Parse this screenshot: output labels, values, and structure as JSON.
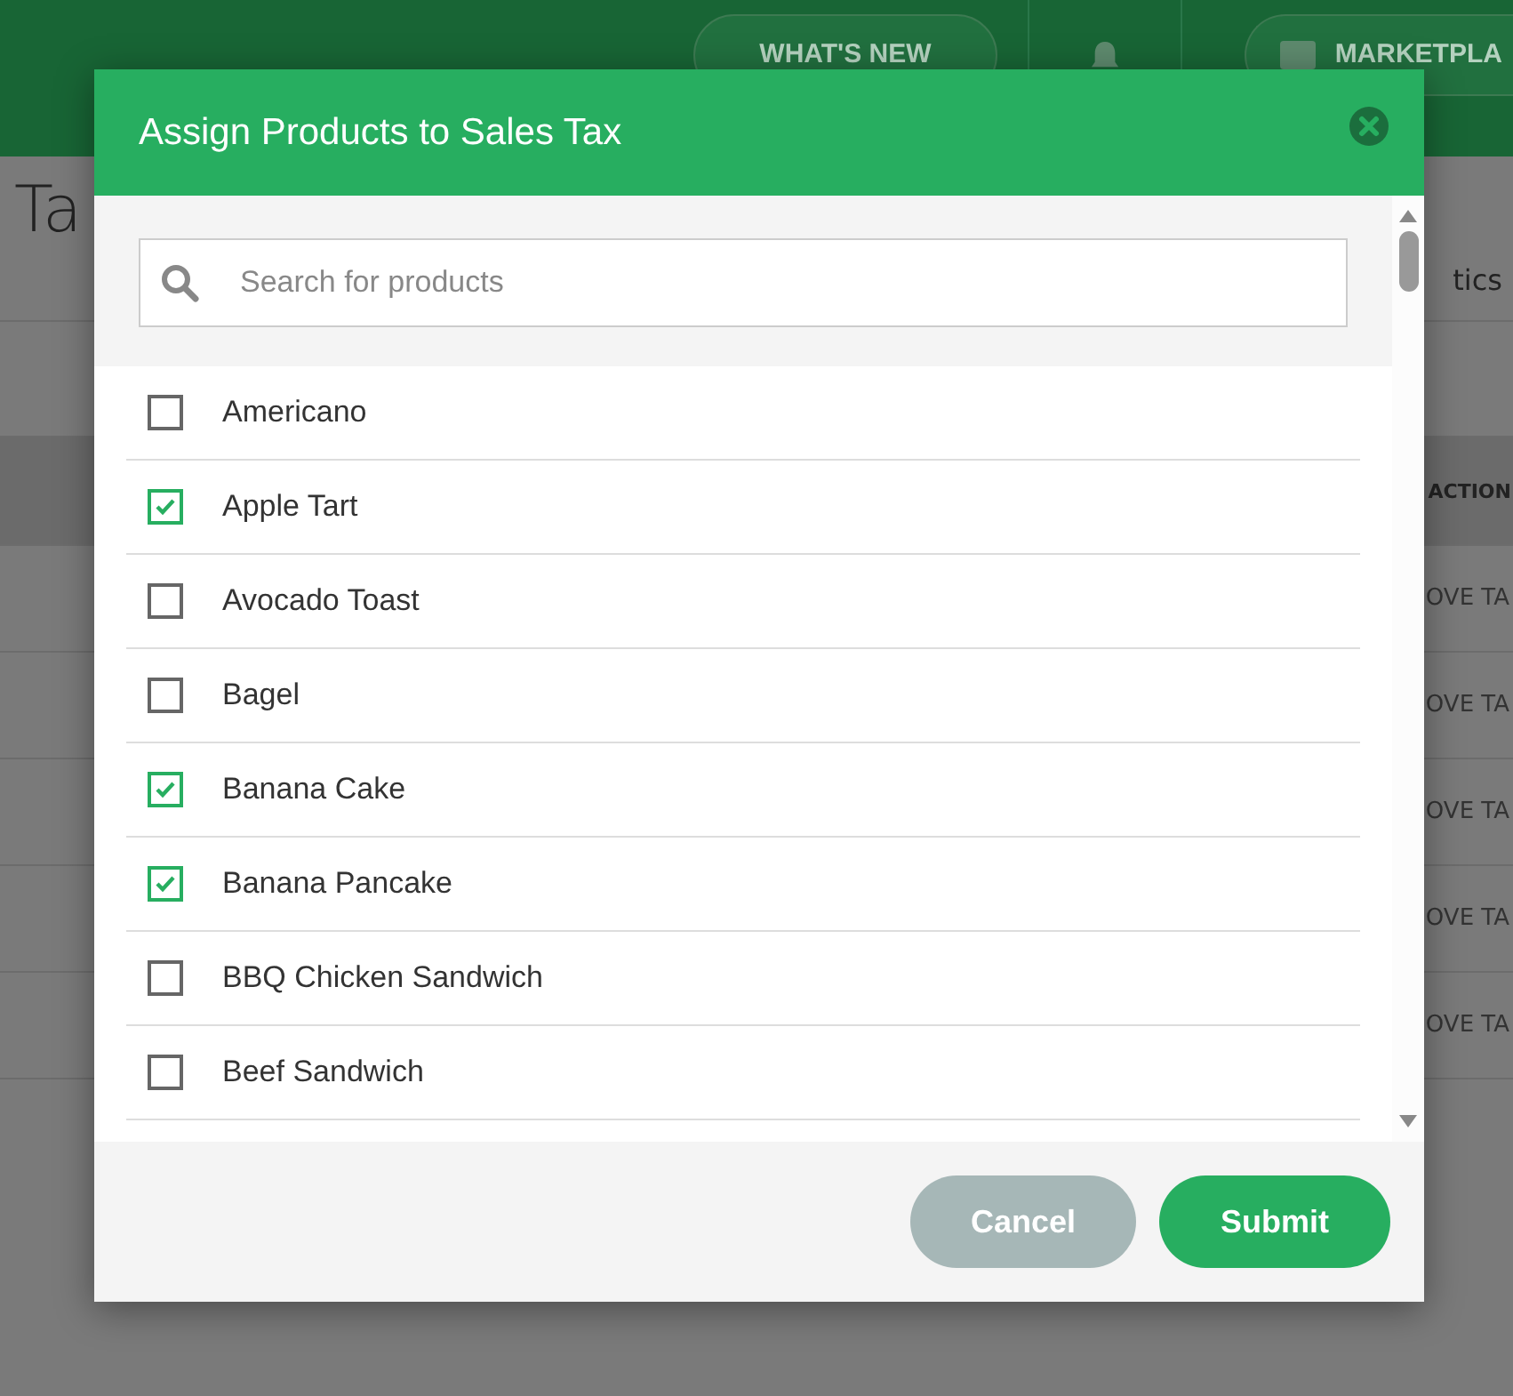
{
  "header": {
    "whats_new": "WHAT'S NEW",
    "marketplace": "MARKETPLA"
  },
  "page": {
    "title": "Ta",
    "side_label": "tics",
    "action_heading": "ACTION",
    "row_actions": [
      "OVE TA",
      "OVE TA",
      "OVE TA",
      "OVE TA",
      "OVE TA"
    ]
  },
  "dialog": {
    "title": "Assign Products to Sales Tax",
    "search": {
      "placeholder": "Search for products"
    },
    "products": [
      {
        "name": "Americano",
        "checked": false
      },
      {
        "name": "Apple Tart",
        "checked": true
      },
      {
        "name": "Avocado Toast",
        "checked": false
      },
      {
        "name": "Bagel",
        "checked": false
      },
      {
        "name": "Banana Cake",
        "checked": true
      },
      {
        "name": "Banana Pancake",
        "checked": true
      },
      {
        "name": "BBQ Chicken Sandwich",
        "checked": false
      },
      {
        "name": "Beef Sandwich",
        "checked": false
      }
    ],
    "buttons": {
      "cancel": "Cancel",
      "submit": "Submit"
    }
  }
}
